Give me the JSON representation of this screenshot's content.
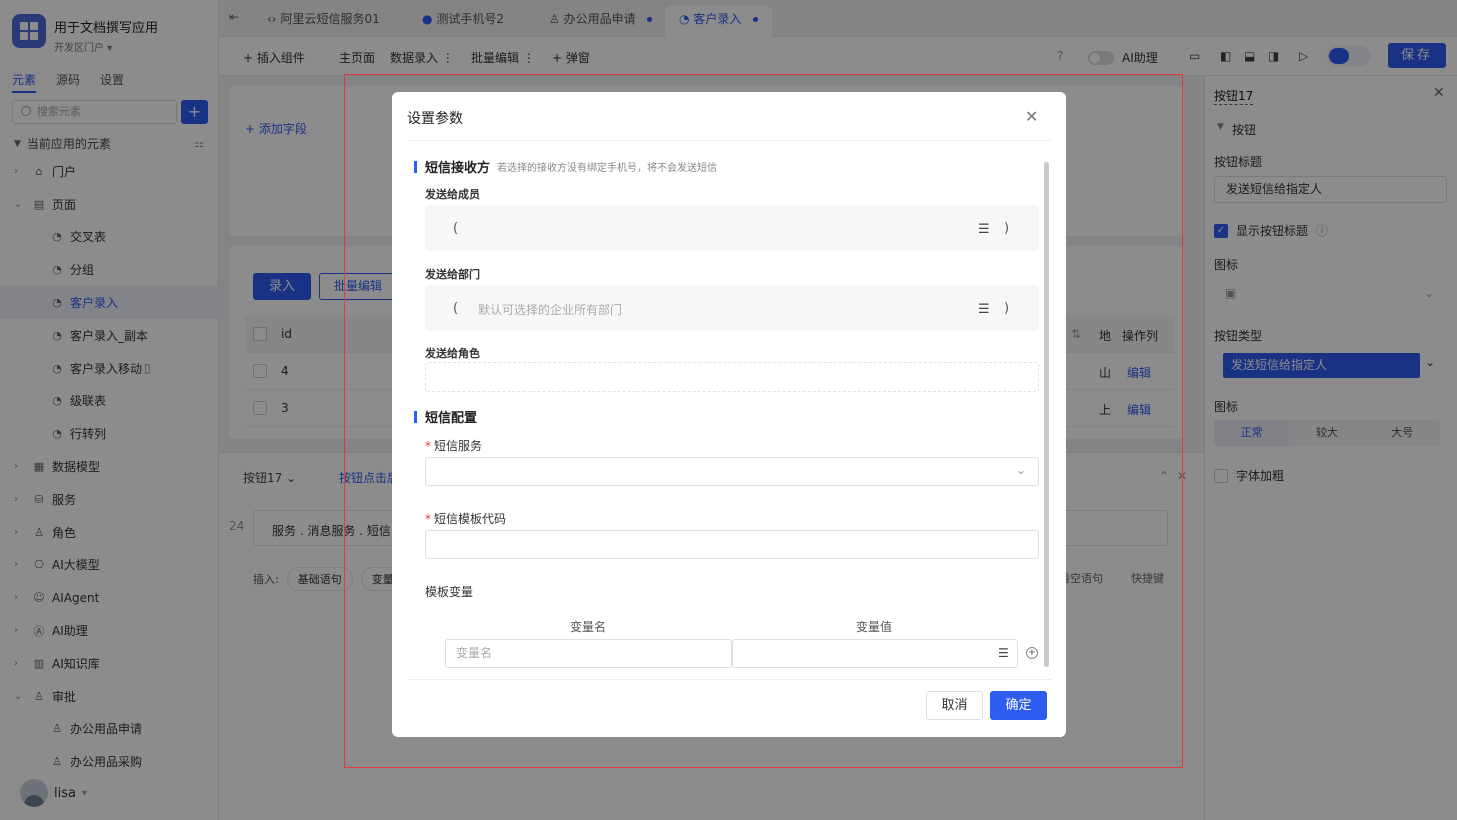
{
  "app": {
    "title": "用于文档撰写应用",
    "subtitle": "开发区门户 ▾",
    "side_tabs": [
      "元素",
      "源码",
      "设置"
    ],
    "search_placeholder": "搜索元素",
    "add_label": "+",
    "section_label": "当前应用的元素"
  },
  "tree": [
    {
      "label": "门户",
      "icon": "home-icon",
      "glyph": "⌂",
      "level": 1,
      "arrow": "›"
    },
    {
      "label": "页面",
      "icon": "page-icon",
      "glyph": "▤",
      "level": 1,
      "arrow": "⌄"
    },
    {
      "label": "交叉表",
      "icon": "page-item-icon",
      "glyph": "◔",
      "level": 2
    },
    {
      "label": "分组",
      "icon": "page-item-icon",
      "glyph": "◔",
      "level": 2
    },
    {
      "label": "客户录入",
      "icon": "page-item-icon",
      "glyph": "◔",
      "level": 2,
      "selected": true
    },
    {
      "label": "客户录入_副本",
      "icon": "page-item-icon",
      "glyph": "◔",
      "level": 2
    },
    {
      "label": "客户录入移动",
      "icon": "page-item-icon",
      "glyph": "◔",
      "level": 2,
      "extra": "▯"
    },
    {
      "label": "级联表",
      "icon": "page-item-icon",
      "glyph": "◔",
      "level": 2
    },
    {
      "label": "行转列",
      "icon": "page-item-icon",
      "glyph": "◔",
      "level": 2
    },
    {
      "label": "数据模型",
      "icon": "table-icon",
      "glyph": "▦",
      "level": 1,
      "arrow": "›"
    },
    {
      "label": "服务",
      "icon": "service-icon",
      "glyph": "⛁",
      "level": 1,
      "arrow": "›"
    },
    {
      "label": "角色",
      "icon": "role-icon",
      "glyph": "♙",
      "level": 1,
      "arrow": "›"
    },
    {
      "label": "AI大模型",
      "icon": "ai-model-icon",
      "glyph": "⎔",
      "level": 1,
      "arrow": "›"
    },
    {
      "label": "AIAgent",
      "icon": "robot-icon",
      "glyph": "☺",
      "level": 1,
      "arrow": "›"
    },
    {
      "label": "AI助理",
      "icon": "ai-assistant-icon",
      "glyph": "Ⓐ",
      "level": 1,
      "arrow": "›"
    },
    {
      "label": "AI知识库",
      "icon": "book-icon",
      "glyph": "▥",
      "level": 1,
      "arrow": "›"
    },
    {
      "label": "审批",
      "icon": "approval-icon",
      "glyph": "♙",
      "level": 1,
      "arrow": "⌄"
    },
    {
      "label": "办公用品申请",
      "icon": "approval-item-icon",
      "glyph": "♙",
      "level": 2
    },
    {
      "label": "办公用品采购",
      "icon": "approval-item-icon",
      "glyph": "♙",
      "level": 2
    }
  ],
  "user": {
    "name": "lisa",
    "caret": "▾"
  },
  "tabs": [
    {
      "label": "阿里云短信服务01",
      "icon": "code-icon",
      "glyph": "‹›"
    },
    {
      "label": "测试手机号2",
      "icon": "circle-icon",
      "glyph": "●"
    },
    {
      "label": "办公用品申请",
      "icon": "approval-icon",
      "glyph": "♙",
      "dot": true
    },
    {
      "label": "客户录入",
      "icon": "page-icon",
      "glyph": "◔",
      "dot": true,
      "active": true
    }
  ],
  "toolbar": {
    "insert_component": "+ 插入组件",
    "main_page": "主页面",
    "data_entry": "数据录入 ⋮",
    "batch_edit": "批量编辑 ⋮",
    "popup": "+ 弹窗",
    "ai_assistant": "AI助理",
    "save": "保存"
  },
  "canvas": {
    "add_field": "+ 添加字段",
    "entry_button": "录入",
    "batch_edit_button": "批量编辑",
    "table": {
      "headers": [
        "id",
        "地",
        "操作列"
      ],
      "rows": [
        {
          "id": "4",
          "addr": "山",
          "action": "编辑"
        },
        {
          "id": "3",
          "addr": "上",
          "action": "编辑"
        }
      ]
    },
    "bottom_tabs": [
      "按钮17 ⌄",
      "按钮点击后"
    ],
    "line_no": "24",
    "code_text": "服务 . 消息服务 . 短信",
    "insert_label": "插入:",
    "insert_pills": [
      "基础语句",
      "变量"
    ],
    "clear_label": "清空语句",
    "shortcut_label": "快捷键"
  },
  "right_panel": {
    "title": "按钮17",
    "group_label": "按钮",
    "button_title_label": "按钮标题",
    "button_title_value": "发送短信给指定人",
    "show_title_label": "显示按钮标题",
    "icon_label": "图标",
    "icon_value": "▣",
    "button_type_label": "按钮类型",
    "button_type_value": "发送短信给指定人",
    "icon_label_2": "图标",
    "size_options": [
      "正常",
      "较大",
      "大号"
    ],
    "bold_label": "字体加粗"
  },
  "modal": {
    "title": "设置参数",
    "section1_title": "短信接收方",
    "section1_hint": "若选择的接收方没有绑定手机号，将不会发送短信",
    "send_to_member": "发送给成员",
    "send_to_dept": "发送给部门",
    "dept_placeholder": "默认可选择的企业所有部门",
    "send_to_role": "发送给角色",
    "section2_title": "短信配置",
    "sms_service_label": "短信服务",
    "sms_template_label": "短信模板代码",
    "template_vars_label": "模板变量",
    "var_name_header": "变量名",
    "var_value_header": "变量值",
    "var_name_placeholder": "变量名",
    "cancel": "取消",
    "confirm": "确定"
  },
  "colors": {
    "accent": "#2e5bf0",
    "highlight_border": "#e23b3b"
  }
}
